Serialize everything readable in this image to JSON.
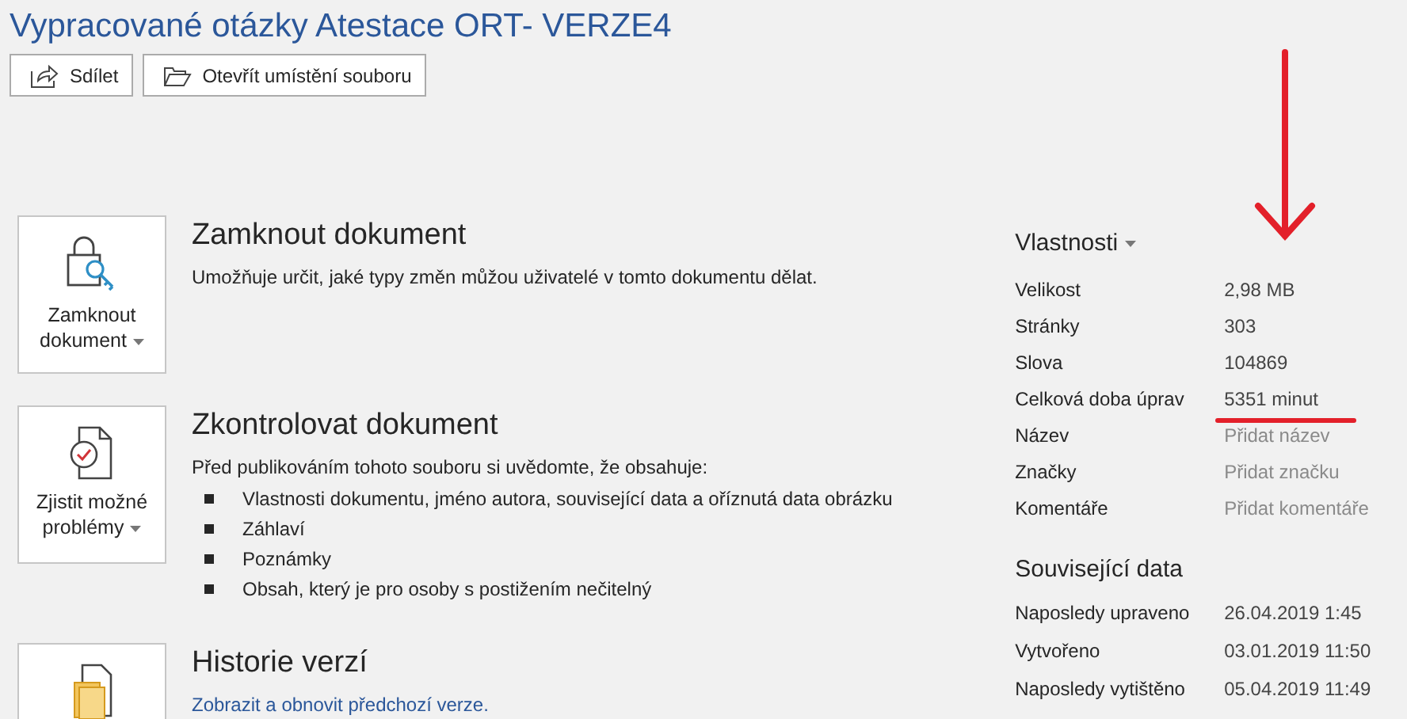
{
  "title": "Vypracované otázky Atestace ORT- VERZE4",
  "actions": [
    {
      "label": "Sdílet"
    },
    {
      "label": "Otevřít umístění souboru"
    }
  ],
  "sections": [
    {
      "button": [
        "Zamknout",
        "dokument"
      ],
      "heading": "Zamknout dokument",
      "text": "Umožňuje určit, jaké typy změn můžou uživatelé v tomto dokumentu dělat."
    },
    {
      "button": [
        "Zjistit možné",
        "problémy"
      ],
      "heading": "Zkontrolovat dokument",
      "text": "Před publikováním tohoto souboru si uvědomte, že obsahuje:",
      "bullets": [
        "Vlastnosti dokumentu, jméno autora, související data a oříznutá data obrázku",
        "Záhlaví",
        "Poznámky",
        "Obsah, který je pro osoby s postižením nečitelný"
      ]
    },
    {
      "heading": "Historie verzí",
      "link": "Zobrazit a obnovit předchozí verze."
    }
  ],
  "properties": {
    "heading": "Vlastnosti",
    "rows": [
      {
        "label": "Velikost",
        "value": "2,98 MB"
      },
      {
        "label": "Stránky",
        "value": "303"
      },
      {
        "label": "Slova",
        "value": "104869"
      },
      {
        "label": "Celková doba úprav",
        "value": "5351 minut",
        "underlined": true
      },
      {
        "label": "Název",
        "placeholder": "Přidat název"
      },
      {
        "label": "Značky",
        "placeholder": "Přidat značku"
      },
      {
        "label": "Komentáře",
        "placeholder": "Přidat komentáře"
      }
    ]
  },
  "related": {
    "heading": "Související data",
    "rows": [
      {
        "label": "Naposledy upraveno",
        "value": "26.04.2019 1:45"
      },
      {
        "label": "Vytvořeno",
        "value": "03.01.2019 11:50"
      },
      {
        "label": "Naposledy vytištěno",
        "value": "05.04.2019 11:49"
      }
    ]
  }
}
